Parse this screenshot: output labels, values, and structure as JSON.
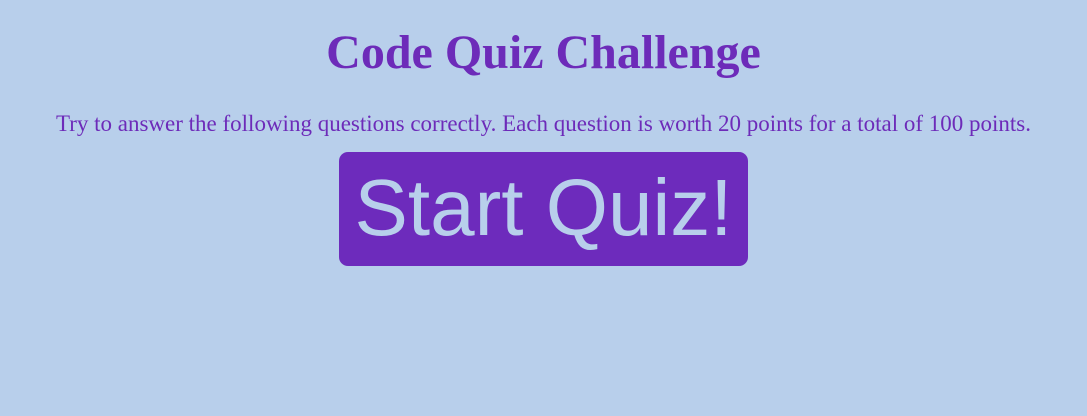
{
  "header": {
    "title": "Code Quiz Challenge"
  },
  "main": {
    "intro_text": "Try to answer the following questions correctly. Each question is worth 20 points for a total of 100 points.",
    "start_button_label": "Start Quiz!"
  },
  "colors": {
    "background": "#b8cfeb",
    "accent": "#6d2bb9"
  }
}
